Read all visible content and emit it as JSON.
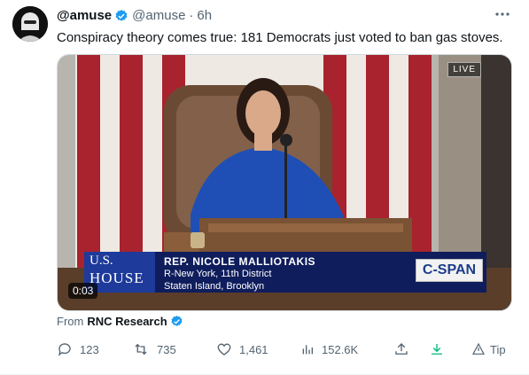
{
  "tweet": {
    "display_name": "@amuse",
    "handle": "@amuse",
    "separator": "·",
    "time": "6h",
    "text": "Conspiracy theory comes true: 181 Democrats just voted to ban gas stoves."
  },
  "video": {
    "live_label": "LIVE",
    "chyron_name": "REP. NICOLE MALLIOTAKIS",
    "chyron_district": "R-New York, 11th District",
    "chyron_location": "Staten Island, Brooklyn",
    "logo_us": "U.S.",
    "logo_house": "HOUSE",
    "network": "C-SPAN",
    "timestamp": "0:03"
  },
  "attribution": {
    "prefix": "From",
    "source": "RNC Research"
  },
  "actions": {
    "replies": "123",
    "retweets": "735",
    "likes": "1,461",
    "views": "152.6K",
    "tip": "Tip"
  },
  "colors": {
    "verified": "#1d9bf0",
    "muted": "#536471",
    "text": "#0f1419",
    "download": "#00ba7c"
  }
}
